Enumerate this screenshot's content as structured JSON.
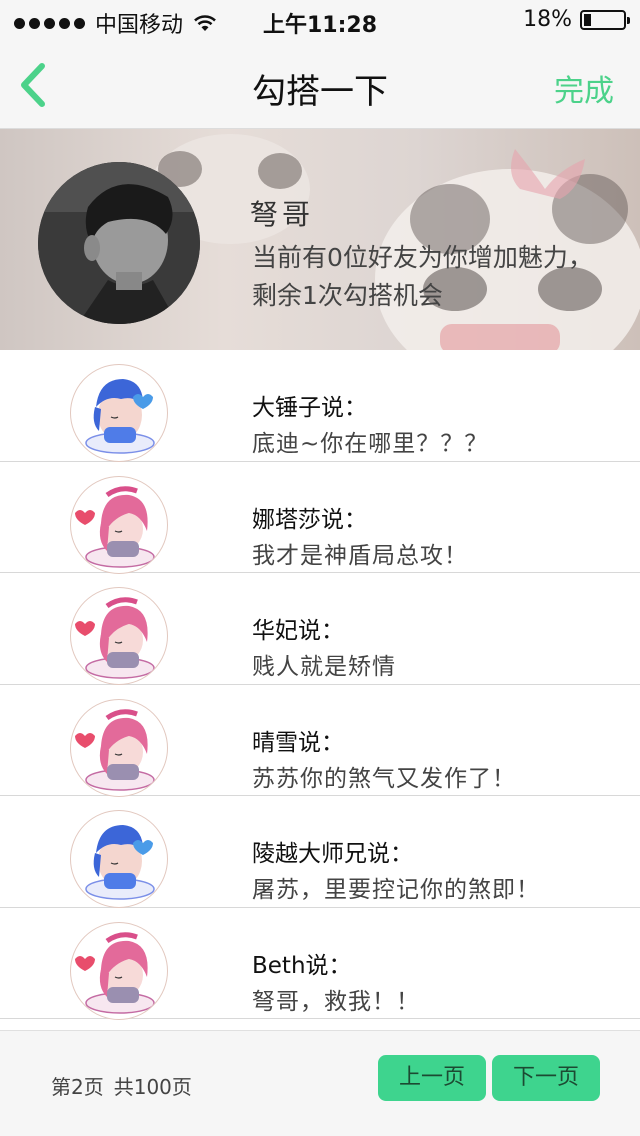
{
  "status_bar": {
    "carrier": "中国移动",
    "time": "上午11:28",
    "battery_text": "18%",
    "battery_level": 0.18
  },
  "nav": {
    "title": "勾搭一下",
    "done_label": "完成"
  },
  "profile": {
    "name": "弩哥",
    "info_line1": "当前有0位好友为你增加魅力，",
    "info_line2": "剩余1次勾搭机会"
  },
  "messages": [
    {
      "sender": "大锤子说：",
      "text": "底迪~你在哪里？？？",
      "avatar": "blue-hair-boy-avatar"
    },
    {
      "sender": "娜塔莎说：",
      "text": "我才是神盾局总攻！",
      "avatar": "pink-hair-girl-avatar"
    },
    {
      "sender": "华妃说：",
      "text": "贱人就是矫情",
      "avatar": "pink-hair-girl-avatar"
    },
    {
      "sender": "晴雪说：",
      "text": "苏苏你的煞气又发作了！",
      "avatar": "pink-hair-girl-avatar"
    },
    {
      "sender": "陵越大师兄说：",
      "text": "屠苏，里要控记你的煞即！",
      "avatar": "blue-hair-boy-avatar"
    },
    {
      "sender": "Beth说：",
      "text": "弩哥，救我！！",
      "avatar": "pink-hair-girl-avatar"
    }
  ],
  "footer": {
    "page_current": "第2页",
    "page_total": "共100页",
    "prev_label": "上一页",
    "next_label": "下一页"
  },
  "colors": {
    "accent": "#4cd28a",
    "button": "#3ed48e"
  }
}
